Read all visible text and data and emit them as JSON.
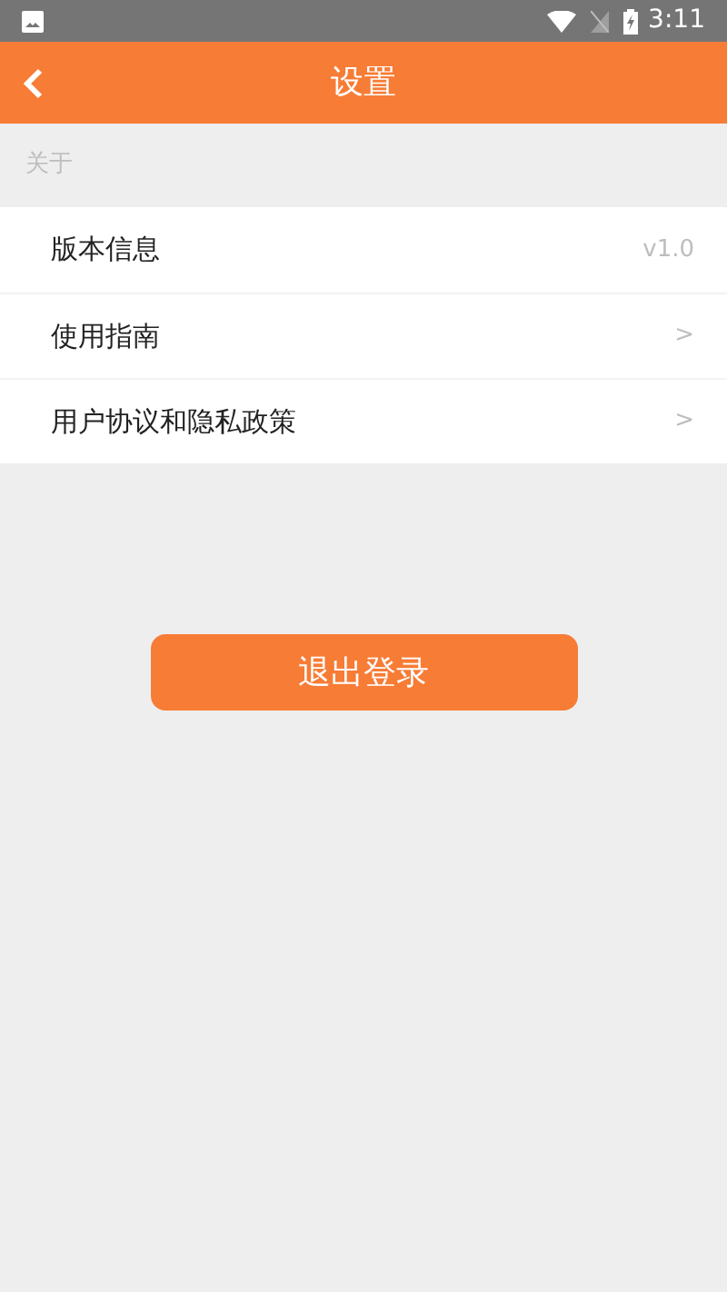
{
  "status_bar": {
    "time": "3:11"
  },
  "header": {
    "title": "设置"
  },
  "section": {
    "title": "关于"
  },
  "items": [
    {
      "label": "版本信息",
      "trailing": "v1.0"
    },
    {
      "label": "使用指南",
      "trailing": ">"
    },
    {
      "label": "用户协议和隐私政策",
      "trailing": ">"
    }
  ],
  "logout_button": "退出登录"
}
